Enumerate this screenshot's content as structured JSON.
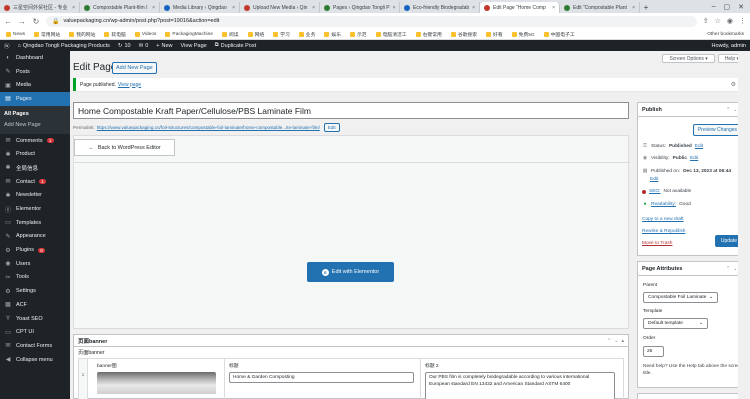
{
  "browser": {
    "tabs": [
      {
        "title": "三星空间外贸社区 - 专业",
        "active": false
      },
      {
        "title": "Compostable Plant-film I",
        "active": false
      },
      {
        "title": "Media Library ‹ Qingdao",
        "active": false
      },
      {
        "title": "Upload New Media ‹ Qin",
        "active": false
      },
      {
        "title": "Pages ‹ Qingdao Tongli P",
        "active": false
      },
      {
        "title": "Eco-friendly Biodegradab",
        "active": false
      },
      {
        "title": "Edit Page “Home Comp",
        "active": true
      },
      {
        "title": "Edit “Compostable Plant",
        "active": false
      }
    ],
    "url": "valuepackaging.cn/wp-admin/post.php?post=19016&action=edit",
    "bookmarks": [
      "News",
      "常用网站",
      "我的网站",
      "软电脑",
      "Videos",
      "PackagingMachine",
      "阅读",
      "网络",
      "学习",
      "业务",
      "娱乐",
      "示范",
      "电脑清洁工",
      "右键常用",
      "谷歌搜索",
      "好看",
      "免费5G",
      "中国电子工"
    ],
    "bookmarks_right": "Other bookmarks"
  },
  "adminbar": {
    "site_name": "Qingdao Tongli Packaging Products",
    "updates": "10",
    "comments": "0",
    "new_label": "New",
    "view_page": "View Page",
    "duplicate": "Duplicate Post",
    "howdy": "Howdy, admin"
  },
  "menu": {
    "items": [
      {
        "label": "Dashboard",
        "icon": "dashboard-icon",
        "glyph": "◐"
      },
      {
        "label": "Posts",
        "icon": "pin-icon",
        "glyph": "✎"
      },
      {
        "label": "Media",
        "icon": "media-icon",
        "glyph": "▣"
      },
      {
        "label": "Pages",
        "icon": "pages-icon",
        "glyph": "▤"
      }
    ],
    "pages_sub": [
      "All Pages",
      "Add New Page"
    ],
    "items2": [
      {
        "label": "Comments",
        "icon": "comments-icon",
        "glyph": "✉",
        "badge": "1"
      },
      {
        "label": "Product",
        "icon": "product-icon",
        "glyph": "✱"
      },
      {
        "label": "全局信息",
        "icon": "globe-icon",
        "glyph": "✱"
      },
      {
        "label": "Contact",
        "icon": "contact-icon",
        "glyph": "✉",
        "badge": "1"
      },
      {
        "label": "Newsletter",
        "icon": "newsletter-icon",
        "glyph": "✱"
      },
      {
        "label": "Elementor",
        "icon": "elementor-icon",
        "glyph": "ⓔ"
      },
      {
        "label": "Templates",
        "icon": "templates-icon",
        "glyph": "▭"
      },
      {
        "label": "Appearance",
        "icon": "appearance-icon",
        "glyph": "✎"
      },
      {
        "label": "Plugins",
        "icon": "plugins-icon",
        "glyph": "⚙",
        "badge": "8"
      },
      {
        "label": "Users",
        "icon": "users-icon",
        "glyph": "◉"
      },
      {
        "label": "Tools",
        "icon": "tools-icon",
        "glyph": "✂"
      },
      {
        "label": "Settings",
        "icon": "settings-icon",
        "glyph": "⚙"
      },
      {
        "label": "ACF",
        "icon": "acf-icon",
        "glyph": "▦"
      },
      {
        "label": "Yoast SEO",
        "icon": "yoast-icon",
        "glyph": "Y"
      },
      {
        "label": "CPT UI",
        "icon": "cptui-icon",
        "glyph": "▭"
      },
      {
        "label": "Contact Forms",
        "icon": "forms-icon",
        "glyph": "✉"
      },
      {
        "label": "Collapse menu",
        "icon": "collapse-icon",
        "glyph": "◀"
      }
    ]
  },
  "screen_options": "Screen Options ▾",
  "help": "Help ▾",
  "page_title": "Edit Page",
  "add_new_page": "Add New Page",
  "notice": {
    "text": "Page published.",
    "link": "View page"
  },
  "post_title": "Home Compostable Kraft Paper/Cellulose/PBS Laminate Film",
  "permalink": {
    "label": "Permalink:",
    "url": "https://www.valuepackaging.cn/foil-structures/compostable-foil-laminate/home-compostable...ite-laminate-film/",
    "edit": "Edit"
  },
  "back_to_editor": "Back to WordPress Editor",
  "edit_with_elementor": "Edit with Elementor",
  "publish": {
    "heading": "Publish",
    "preview": "Preview Changes",
    "status_label": "Status:",
    "status_value": "Published",
    "status_edit": "Edit",
    "visibility_label": "Visibility:",
    "visibility_value": "Public",
    "visibility_edit": "Edit",
    "published_label": "Published on:",
    "published_value": "Dec 13, 2023 at 06:44",
    "published_edit": "Edit",
    "seo_label": "SEO:",
    "seo_value": "Not available",
    "readability_label": "Readability:",
    "readability_value": "Good",
    "copy_draft": "Copy to a new draft",
    "rewrite": "Rewrite & Republish",
    "trash": "Move to Trash",
    "update": "Update"
  },
  "attributes": {
    "heading": "Page Attributes",
    "parent_label": "Parent",
    "parent_value": "Compostable Foil Laminate",
    "template_label": "Template",
    "template_value": "Default template",
    "order_label": "Order",
    "order_value": "26",
    "help": "Need help? Use the Help tab above the screen title."
  },
  "banner": {
    "heading": "页面banner",
    "sub": "页面banner",
    "col_image": "banner图",
    "col_title": "标题",
    "col_title2": "标题 2",
    "row_num": "1",
    "title_value": "Home & Garden Composting",
    "title2_value": "Our PBS film is completely biodegradable according to various international European standard EN 13432 and American Standard ASTM 6400"
  }
}
